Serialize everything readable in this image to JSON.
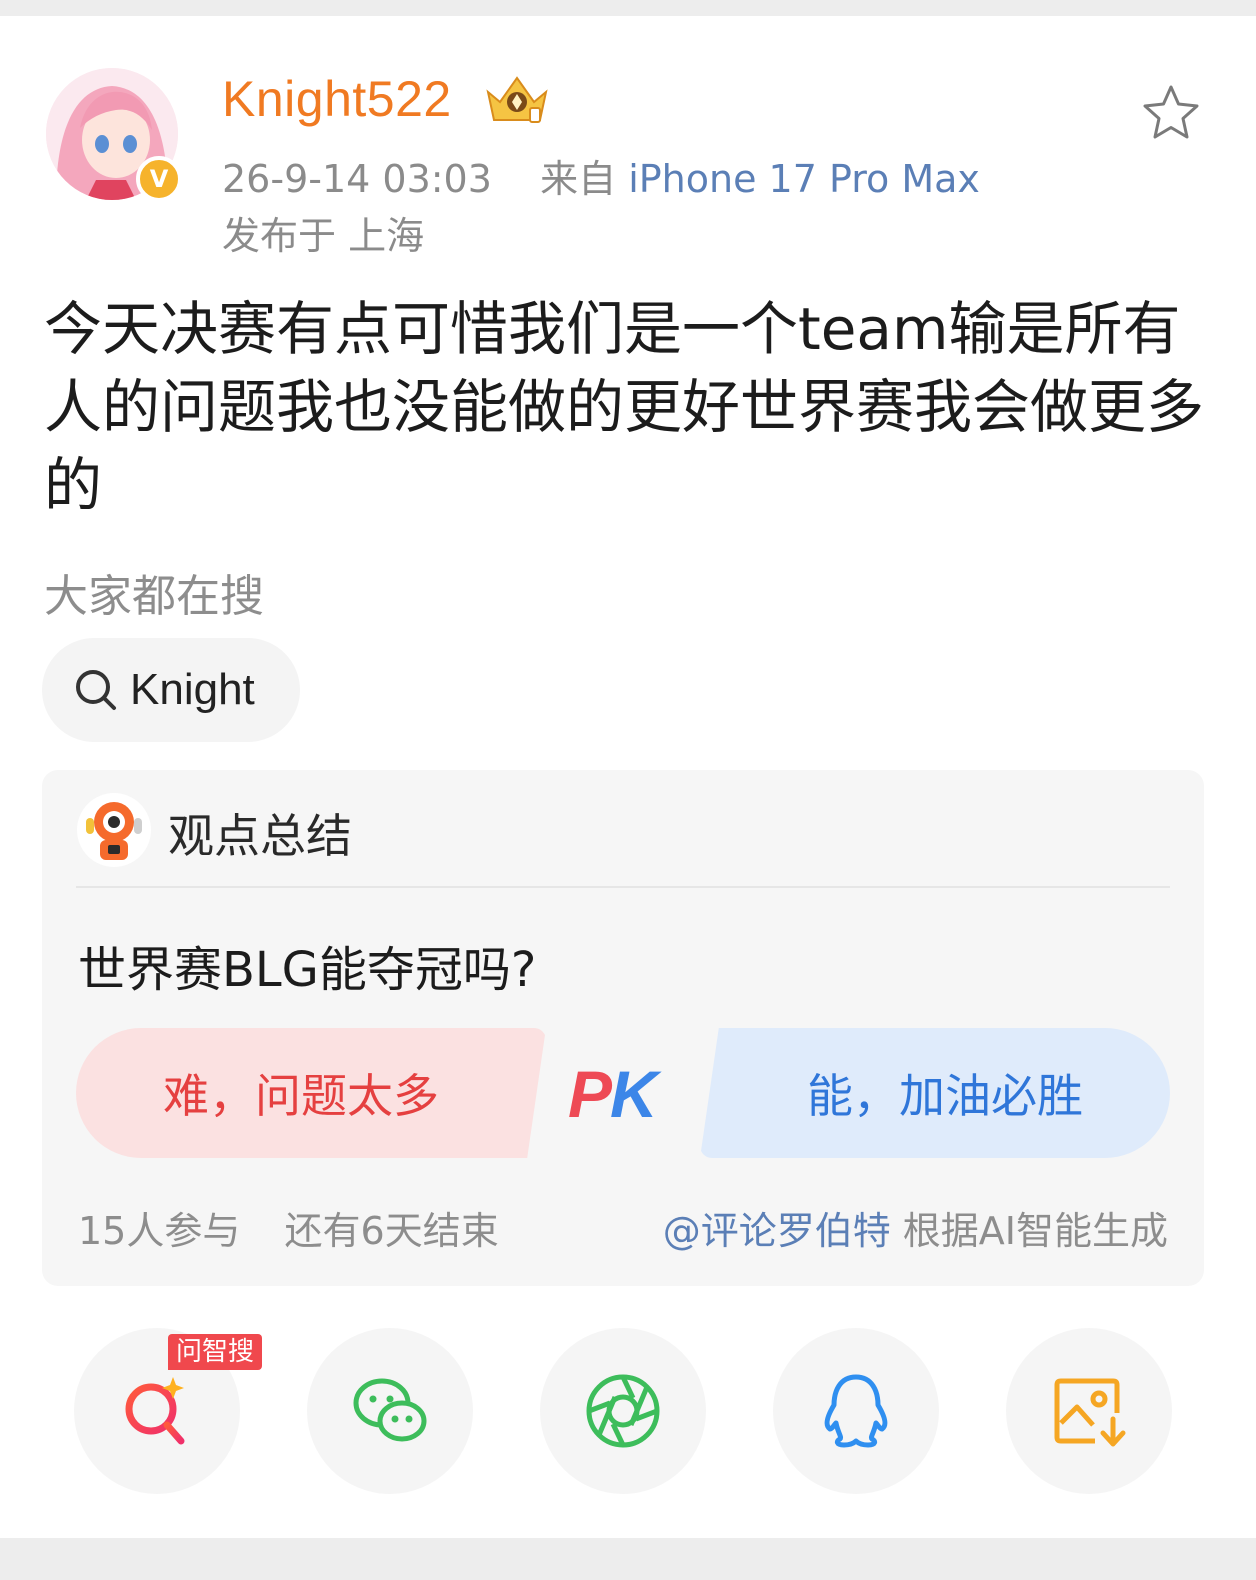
{
  "header": {
    "username": "Knight522",
    "timestamp": "26-9-14 03:03",
    "source_prefix": "来自",
    "device": "iPhone 17 Pro Max",
    "location": "发布于 上海",
    "verified_badge": "V",
    "icons": [
      "crown-icon",
      "star-icon"
    ]
  },
  "post": {
    "text": "今天决赛有点可惜我们是一个team输是所有人的问题我也没能做的更好世界赛我会做更多的"
  },
  "hot_search": {
    "label": "大家都在搜",
    "chip": "Knight"
  },
  "summary": {
    "title": "观点总结",
    "question": "世界赛BLG能夺冠吗?",
    "option_left": "难，问题太多",
    "option_right": "能，加油必胜",
    "pk_p": "P",
    "pk_k": "K",
    "participants": "15人参与",
    "remaining": "还有6天结束",
    "mention": "@评论罗伯特",
    "generated_by": "根据AI智能生成"
  },
  "share": {
    "badge": "问智搜",
    "buttons": [
      "ai-search-icon",
      "wechat-icon",
      "moments-icon",
      "qq-icon",
      "save-image-icon"
    ]
  },
  "colors": {
    "username": "#f07a22",
    "link": "#5b7fb6",
    "pk_red": "#ee4a55",
    "pk_blue": "#3c86e8"
  }
}
